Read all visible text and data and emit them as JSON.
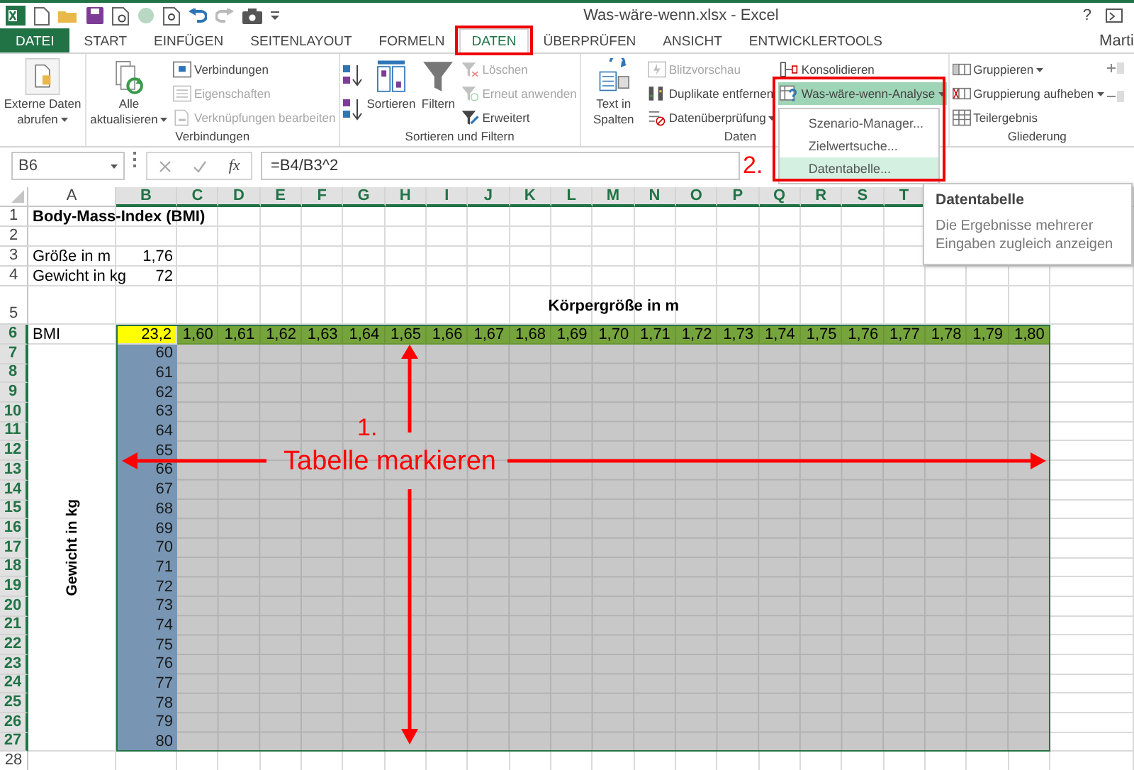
{
  "window": {
    "title": "Was-wäre-wenn.xlsx - Excel",
    "help": "?"
  },
  "tabs": [
    {
      "label": "DATEI",
      "kind": "file",
      "selected": false
    },
    {
      "label": "START",
      "kind": "tab",
      "selected": false
    },
    {
      "label": "EINFÜGEN",
      "kind": "tab",
      "selected": false
    },
    {
      "label": "SEITENLAYOUT",
      "kind": "tab",
      "selected": false
    },
    {
      "label": "FORMELN",
      "kind": "tab",
      "selected": false
    },
    {
      "label": "DATEN",
      "kind": "tab",
      "selected": true
    },
    {
      "label": "ÜBERPRÜFEN",
      "kind": "tab",
      "selected": false
    },
    {
      "label": "ANSICHT",
      "kind": "tab",
      "selected": false
    },
    {
      "label": "ENTWICKLERTOOLS",
      "kind": "tab",
      "selected": false
    }
  ],
  "account": {
    "name": "Marti"
  },
  "ribbon": {
    "groups": [
      {
        "columns": [
          {
            "kind": "large",
            "label": "Externe Daten abrufen",
            "dropdown": true,
            "disabled": false
          }
        ]
      },
      {
        "label": "Verbindungen",
        "columns": [
          {
            "kind": "large",
            "label": "Alle aktualisieren",
            "dropdown": true,
            "disabled": false
          },
          {
            "kind": "stack",
            "items": [
              {
                "label": "Verbindungen",
                "disabled": false
              },
              {
                "label": "Eigenschaften",
                "disabled": true
              },
              {
                "label": "Verknüpfungen bearbeiten",
                "disabled": true
              }
            ]
          }
        ]
      },
      {
        "label": "Sortieren und Filtern",
        "columns": [
          {
            "kind": "sort"
          },
          {
            "kind": "large",
            "label": "Sortieren",
            "disabled": false
          },
          {
            "kind": "large",
            "label": "Filtern",
            "disabled": false
          },
          {
            "kind": "stack",
            "items": [
              {
                "label": "Löschen",
                "disabled": true
              },
              {
                "label": "Erneut anwenden",
                "disabled": true
              },
              {
                "label": "Erweitert",
                "disabled": false
              }
            ]
          }
        ]
      },
      {
        "label": "Daten",
        "columns": [
          {
            "kind": "large",
            "label": "Text in Spalten",
            "disabled": false
          },
          {
            "kind": "stack",
            "items": [
              {
                "label": "Blitzvorschau",
                "disabled": true
              },
              {
                "label": "Duplikate entfernen",
                "disabled": false
              },
              {
                "label": "Datenüberprüfung",
                "disabled": false,
                "dropdown": true
              }
            ]
          },
          {
            "kind": "stack",
            "items": [
              {
                "label": "Konsolidieren",
                "disabled": false
              },
              {
                "label": "Was-wäre-wenn-Analyse",
                "disabled": false,
                "dropdown": true,
                "pressed": true,
                "menu": [
                  {
                    "label": "Szenario-Manager...",
                    "selected": false
                  },
                  {
                    "label": "Zielwertsuche...",
                    "selected": false
                  },
                  {
                    "label": "Datentabelle...",
                    "selected": true
                  }
                ]
              }
            ]
          }
        ]
      },
      {
        "label": "Gliederung",
        "columns": [
          {
            "kind": "stack",
            "items": [
              {
                "label": "Gruppieren",
                "disabled": false,
                "dropdown": true
              },
              {
                "label": "Gruppierung aufheben",
                "disabled": false,
                "dropdown": true
              },
              {
                "label": "Teilergebnis",
                "disabled": false
              }
            ]
          },
          {
            "kind": "mini"
          }
        ]
      }
    ]
  },
  "formula_bar": {
    "name_box": "B6",
    "function_label": "fx",
    "formula": "=B4/B3^2"
  },
  "sheet": {
    "columns": [
      {
        "label": "A",
        "selected": false
      },
      {
        "label": "B",
        "selected": true
      },
      {
        "label": "C",
        "selected": true
      },
      {
        "label": "D",
        "selected": true
      },
      {
        "label": "E",
        "selected": true
      },
      {
        "label": "F",
        "selected": true
      },
      {
        "label": "G",
        "selected": true
      },
      {
        "label": "H",
        "selected": true
      },
      {
        "label": "I",
        "selected": true
      },
      {
        "label": "J",
        "selected": true
      },
      {
        "label": "K",
        "selected": true
      },
      {
        "label": "L",
        "selected": true
      },
      {
        "label": "M",
        "selected": true
      },
      {
        "label": "N",
        "selected": true
      },
      {
        "label": "O",
        "selected": true
      },
      {
        "label": "P",
        "selected": true
      },
      {
        "label": "Q",
        "selected": true
      },
      {
        "label": "R",
        "selected": true
      },
      {
        "label": "S",
        "selected": true
      },
      {
        "label": "T",
        "selected": true
      }
    ],
    "rows": [
      {
        "label": "1",
        "selected": false
      },
      {
        "label": "2",
        "selected": false
      },
      {
        "label": "3",
        "selected": false
      },
      {
        "label": "4",
        "selected": false
      },
      {
        "label": "5",
        "selected": false
      },
      {
        "label": "6",
        "selected": true
      },
      {
        "label": "7",
        "selected": true
      },
      {
        "label": "8",
        "selected": true
      },
      {
        "label": "9",
        "selected": true
      },
      {
        "label": "10",
        "selected": true
      },
      {
        "label": "11",
        "selected": true
      },
      {
        "label": "12",
        "selected": true
      },
      {
        "label": "13",
        "selected": true
      },
      {
        "label": "14",
        "selected": true
      },
      {
        "label": "15",
        "selected": true
      },
      {
        "label": "16",
        "selected": true
      },
      {
        "label": "17",
        "selected": true
      },
      {
        "label": "18",
        "selected": true
      },
      {
        "label": "19",
        "selected": true
      },
      {
        "label": "20",
        "selected": true
      },
      {
        "label": "21",
        "selected": true
      },
      {
        "label": "22",
        "selected": true
      },
      {
        "label": "23",
        "selected": true
      },
      {
        "label": "24",
        "selected": true
      },
      {
        "label": "25",
        "selected": true
      },
      {
        "label": "26",
        "selected": true
      },
      {
        "label": "27",
        "selected": true
      },
      {
        "label": "28",
        "selected": false
      }
    ],
    "title": "Body-Mass-Index (BMI)",
    "inputs": [
      {
        "label": "Größe in m",
        "value": "1,76"
      },
      {
        "label": "Gewicht in kg",
        "value": "72"
      }
    ],
    "data_table": {
      "column_heading": "Körpergröße in m",
      "row_heading": "Gewicht in kg",
      "corner_label": "BMI",
      "result": "23,2",
      "heights": [
        "1,60",
        "1,61",
        "1,62",
        "1,63",
        "1,64",
        "1,65",
        "1,66",
        "1,67",
        "1,68",
        "1,69",
        "1,70",
        "1,71",
        "1,72",
        "1,73",
        "1,74",
        "1,75",
        "1,76",
        "1,77",
        "1,78",
        "1,79",
        "1,80"
      ],
      "weights": [
        "60",
        "61",
        "62",
        "63",
        "64",
        "65",
        "66",
        "67",
        "68",
        "69",
        "70",
        "71",
        "72",
        "73",
        "74",
        "75",
        "76",
        "77",
        "78",
        "79",
        "80"
      ]
    }
  },
  "tooltip": {
    "title": "Datentabelle",
    "text": "Die Ergebnisse mehrerer Eingaben zugleich anzeigen"
  },
  "annotations": [
    {
      "kind": "step",
      "text": "1."
    },
    {
      "kind": "instruction",
      "text": "Tabelle markieren"
    },
    {
      "kind": "step",
      "text": "2."
    }
  ]
}
